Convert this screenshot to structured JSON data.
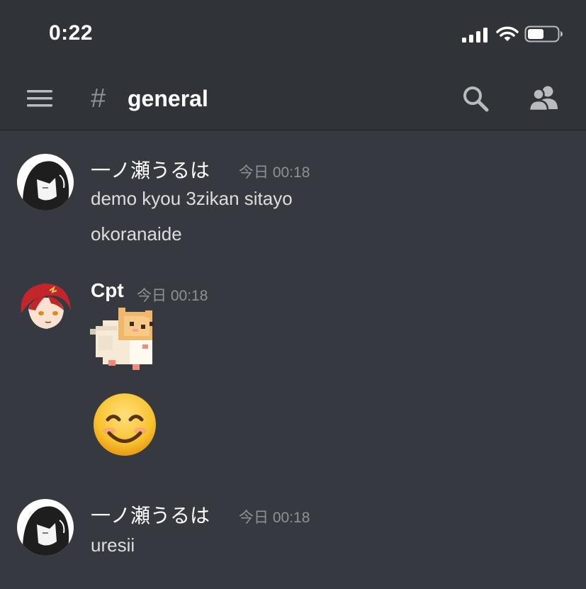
{
  "status_bar": {
    "time": "0:22"
  },
  "header": {
    "channel_hash": "#",
    "channel_name": "general"
  },
  "icons": {
    "menu": "hamburger-icon",
    "search": "search-icon",
    "members": "members-icon",
    "signal": "signal-icon",
    "wifi": "wifi-icon",
    "battery": "battery-icon"
  },
  "colors": {
    "background": "#36393f",
    "header_background": "#303338",
    "text_primary": "#ffffff",
    "text_message": "#dcddde",
    "text_muted": "#8e9297"
  },
  "messages": [
    {
      "author": "一ノ瀬うるは",
      "timestamp": "今日 00:18",
      "lines": [
        "demo kyou 3zikan sitayo",
        "okoranaide"
      ]
    },
    {
      "author": "Cpt",
      "timestamp": "今日 00:18",
      "stickers": [
        "hamster-sticker",
        "smiling-face-emoji"
      ]
    },
    {
      "author": "一ノ瀬うるは",
      "timestamp": "今日 00:18",
      "lines": [
        "uresii"
      ]
    }
  ]
}
